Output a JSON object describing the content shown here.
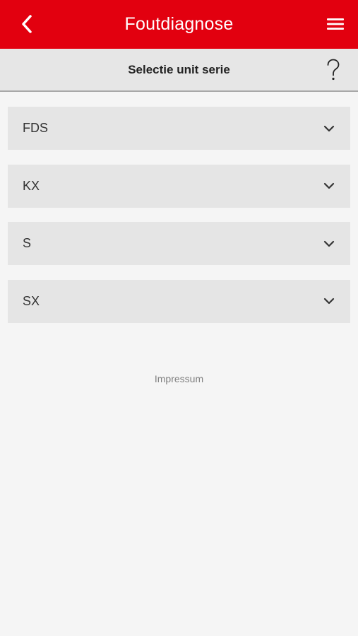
{
  "header": {
    "title": "Foutdiagnose",
    "back_icon": "chevron-left-icon",
    "menu_icon": "hamburger-menu-icon",
    "background_color": "#e2000f"
  },
  "sub_header": {
    "title": "Selectie unit serie",
    "help_icon": "question-mark-icon"
  },
  "series": [
    {
      "label": "FDS"
    },
    {
      "label": "KX"
    },
    {
      "label": "S"
    },
    {
      "label": "SX"
    }
  ],
  "footer": {
    "impressum": "Impressum"
  }
}
